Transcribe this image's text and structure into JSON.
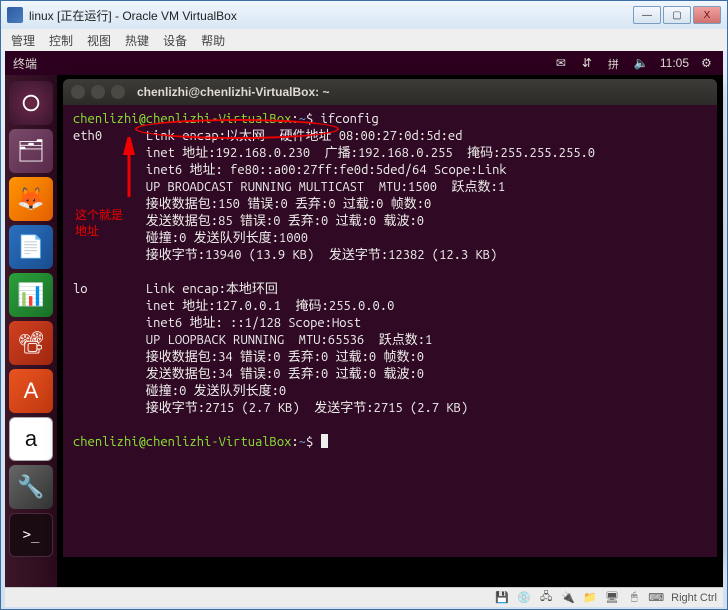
{
  "win": {
    "title": "linux [正在运行] - Oracle VM VirtualBox",
    "min": "—",
    "max": "▢",
    "close": "X"
  },
  "vbox_menu": [
    "管理",
    "控制",
    "视图",
    "热键",
    "设备",
    "帮助"
  ],
  "ubuntu": {
    "top_label": "终端",
    "time": "11:05"
  },
  "terminal": {
    "title": "chenlizhi@chenlizhi-VirtualBox: ~",
    "prompt_user": "chenlizhi@chenlizhi-VirtualBox",
    "prompt_path": "~",
    "cmd": "ifconfig",
    "output": "eth0      Link encap:以太网  硬件地址 08:00:27:0d:5d:ed\n          inet 地址:192.168.0.230  广播:192.168.0.255  掩码:255.255.255.0\n          inet6 地址: fe80::a00:27ff:fe0d:5ded/64 Scope:Link\n          UP BROADCAST RUNNING MULTICAST  MTU:1500  跃点数:1\n          接收数据包:150 错误:0 丢弃:0 过载:0 帧数:0\n          发送数据包:85 错误:0 丢弃:0 过载:0 载波:0\n          碰撞:0 发送队列长度:1000\n          接收字节:13940 (13.9 KB)  发送字节:12382 (12.3 KB)\n\nlo        Link encap:本地环回\n          inet 地址:127.0.0.1  掩码:255.0.0.0\n          inet6 地址: ::1/128 Scope:Host\n          UP LOOPBACK RUNNING  MTU:65536  跃点数:1\n          接收数据包:34 错误:0 丢弃:0 过载:0 帧数:0\n          发送数据包:34 错误:0 丢弃:0 过载:0 载波:0\n          碰撞:0 发送队列长度:0\n          接收字节:2715 (2.7 KB)  发送字节:2715 (2.7 KB)\n"
  },
  "annotation": {
    "line1": "这个就是",
    "line2": "地址"
  },
  "status": {
    "host_key": "Right Ctrl"
  }
}
